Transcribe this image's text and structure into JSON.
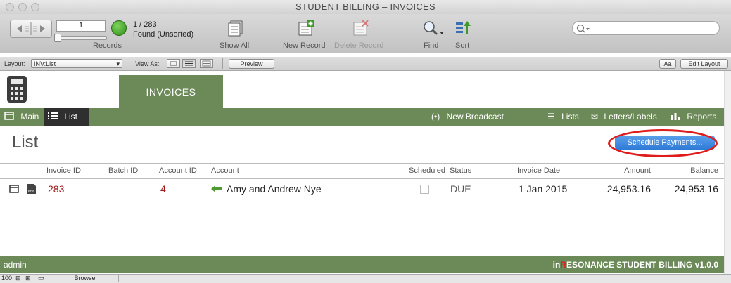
{
  "window": {
    "title": "STUDENT BILLING – INVOICES"
  },
  "toolbar": {
    "record_number": "1",
    "record_count": "1 / 283",
    "found_status": "Found (Unsorted)",
    "records_label": "Records",
    "show_all_label": "Show All",
    "new_record_label": "New Record",
    "delete_record_label": "Delete Record",
    "find_label": "Find",
    "sort_label": "Sort"
  },
  "layout_bar": {
    "layout_label": "Layout:",
    "layout_value": "INV:List",
    "view_as_label": "View As:",
    "preview_label": "Preview",
    "aa_label": "Aa",
    "edit_layout_label": "Edit Layout"
  },
  "tabs": {
    "invoices": "INVOICES"
  },
  "nav": {
    "main": "Main",
    "list": "List",
    "broadcast": "New Broadcast",
    "lists": "Lists",
    "letters": "Letters/Labels",
    "reports": "Reports"
  },
  "page": {
    "title": "List",
    "schedule_button": "Schedule Payments..."
  },
  "table": {
    "headers": {
      "invoice_id": "Invoice ID",
      "batch_id": "Batch ID",
      "account_id": "Account ID",
      "account": "Account",
      "scheduled": "Scheduled",
      "status": "Status",
      "invoice_date": "Invoice Date",
      "amount": "Amount",
      "balance": "Balance"
    },
    "rows": [
      {
        "invoice_id": "283",
        "batch_id": "",
        "account_id": "4",
        "account": "Amy and Andrew Nye",
        "scheduled": false,
        "status": "DUE",
        "invoice_date": "1 Jan 2015",
        "amount": "24,953.16",
        "balance": "24,953.16"
      }
    ]
  },
  "footer": {
    "user": "admin",
    "brand_prefix": "in",
    "brand_r": "R",
    "brand_rest": "ESONANCE STUDENT BILLING v1.0.0"
  },
  "status": {
    "zoom": "100",
    "mode": "Browse"
  },
  "colors": {
    "accent_green": "#6c8a58",
    "button_blue": "#3a86df",
    "highlight_red": "#e01b1b",
    "id_red": "#a11a1a"
  }
}
